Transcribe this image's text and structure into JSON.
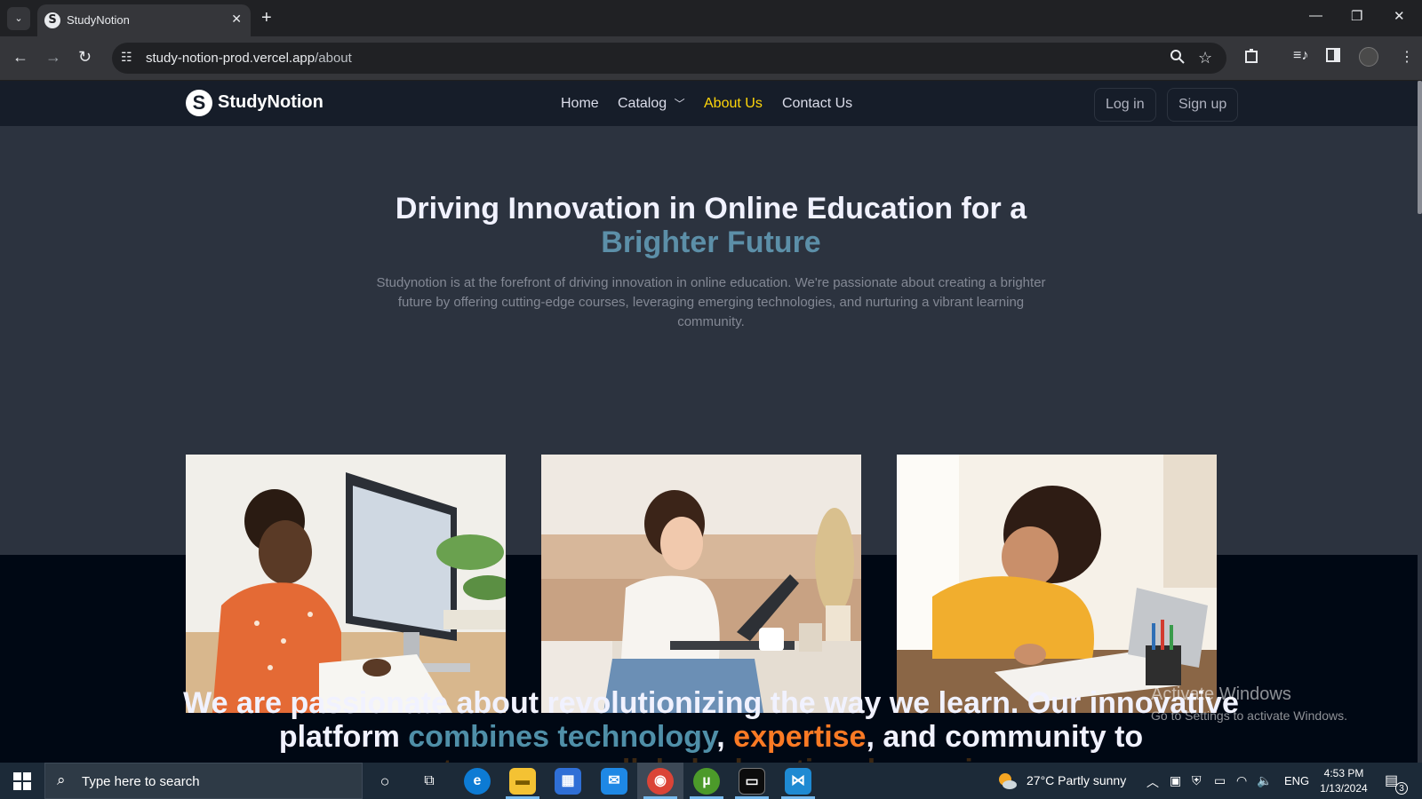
{
  "browser": {
    "tab": {
      "favicon": "S",
      "title": "StudyNotion",
      "close_icon": "close-icon"
    },
    "new_tab_label": "+",
    "url_domain": "study-notion-prod.vercel.app",
    "url_path": "/about",
    "icons": [
      "back-icon",
      "forward-icon",
      "reload-icon",
      "site-info-icon",
      "zoom-icon",
      "star-icon",
      "extensions-icon",
      "media-icon",
      "side-panel-icon",
      "profile-avatar",
      "menu-icon"
    ]
  },
  "site": {
    "logo_mark": "S",
    "logo_text": "StudyNotion",
    "nav": {
      "home": "Home",
      "catalog": "Catalog",
      "about": "About Us",
      "contact": "Contact Us"
    },
    "login": "Log in",
    "signup": "Sign up"
  },
  "hero": {
    "title": "Driving Innovation in Online Education for a",
    "highlight": "Brighter Future",
    "description": "Studynotion is at the forefront of driving innovation in online education. We're passionate about creating a brighter future by offering cutting-edge courses, leveraging emerging technologies, and nurturing a vibrant learning community."
  },
  "photos": [
    "Woman working at a computer",
    "Woman writing at a coffee table",
    "Student writing at a desk"
  ],
  "quote": {
    "part1": "We are passionate about revolutionizing the way we learn. Our innovative platform ",
    "blue": "combines technology",
    "comma": ", ",
    "orange": "expertise",
    "part2": ", and community to",
    "faint": "create an unparalleled educational experience"
  },
  "watermark": {
    "title": "Activate Windows",
    "subtitle": "Go to Settings to activate Windows."
  },
  "taskbar": {
    "search_placeholder": "Type here to search",
    "weather": "27°C  Partly sunny",
    "language": "ENG",
    "time": "4:53 PM",
    "date": "1/13/2024",
    "notification_count": "3"
  }
}
